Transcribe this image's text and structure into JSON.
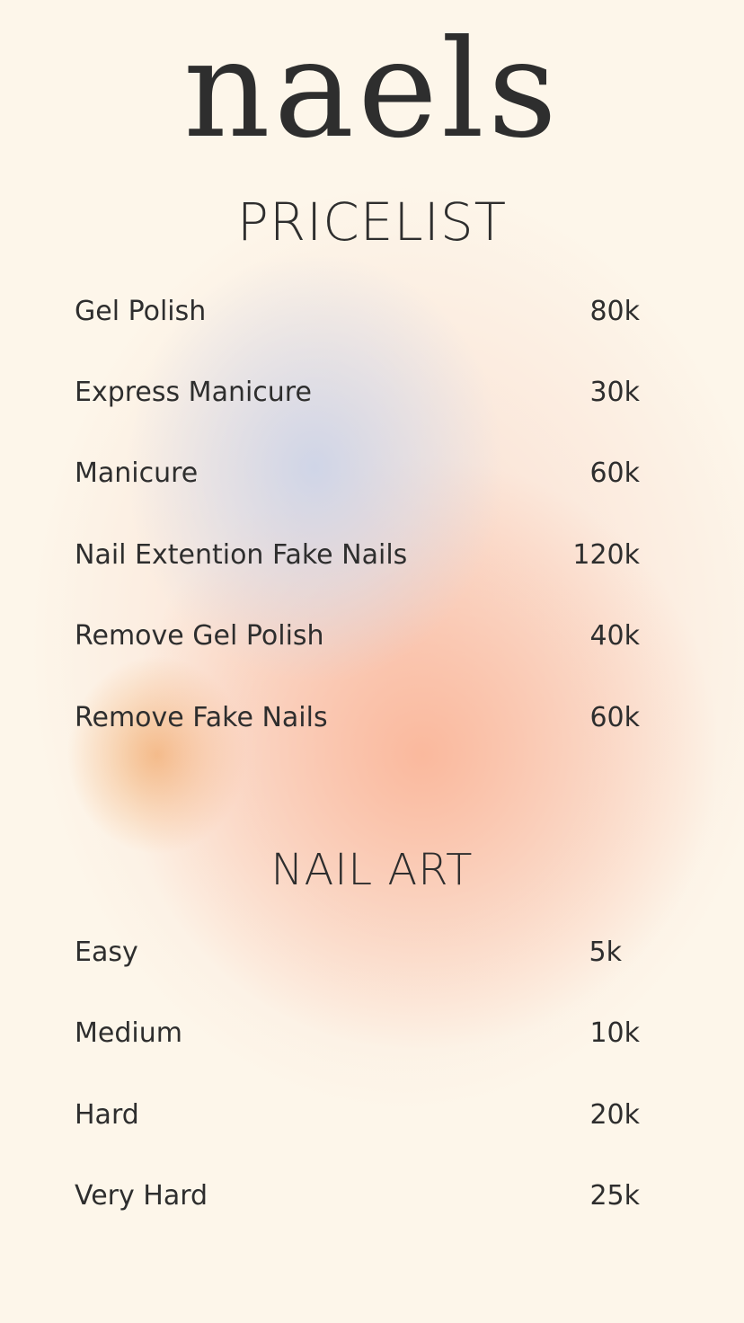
{
  "brand": "naels",
  "subtitle": "PRICELIST",
  "services": [
    {
      "name": "Gel Polish",
      "price": "80k"
    },
    {
      "name": "Express Manicure",
      "price": "30k"
    },
    {
      "name": "Manicure",
      "price": "60k"
    },
    {
      "name": "Nail Extention Fake Nails",
      "price": "120k"
    },
    {
      "name": "Remove Gel Polish",
      "price": "40k"
    },
    {
      "name": "Remove Fake Nails",
      "price": "60k"
    }
  ],
  "nail_art": {
    "title": "NAIL ART",
    "items": [
      {
        "name": "Easy",
        "price": "5k"
      },
      {
        "name": "Medium",
        "price": "10k"
      },
      {
        "name": "Hard",
        "price": "20k"
      },
      {
        "name": "Very Hard",
        "price": "25k"
      }
    ]
  },
  "colors": {
    "background": "#fdf6ea",
    "text": "#2e2e2e",
    "blur_blue": "#cdd4e8",
    "blur_peach": "#fab294",
    "blur_orange": "#f2b278"
  }
}
